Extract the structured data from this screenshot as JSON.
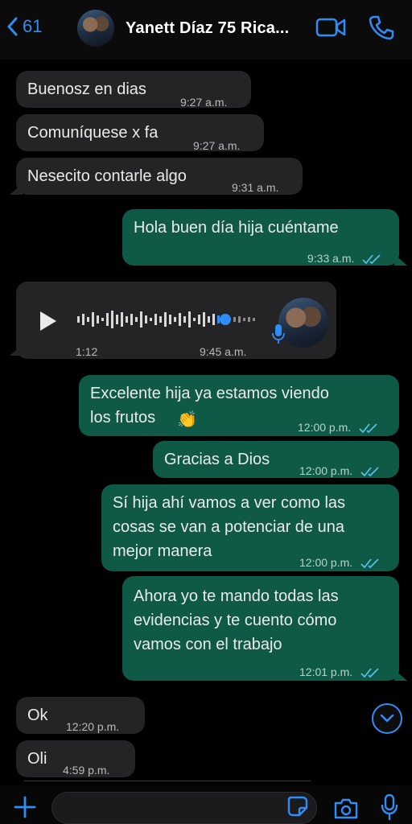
{
  "header": {
    "back_count": "61",
    "contact_name": "Yanett Díaz 75 Rica..."
  },
  "messages": [
    {
      "text": "Buenosz en dias",
      "time": "9:27 a.m."
    },
    {
      "text": "Comuníquese x fa",
      "time": "9:27 a.m."
    },
    {
      "text": "Nesecito contarle algo",
      "time": "9:31 a.m."
    },
    {
      "text": "Hola buen día hija cuéntame",
      "time": "9:33 a.m."
    },
    {
      "duration": "1:12",
      "time": "9:45 a.m."
    },
    {
      "text_line1": "Excelente hija ya estamos viendo",
      "text_line2": "los frutos",
      "emoji": "👏",
      "time": "12:00 p.m."
    },
    {
      "text": "Gracias a Dios",
      "time": "12:00 p.m."
    },
    {
      "text_line1": "Sí hija ahí vamos a ver como las",
      "text_line2": "cosas se van a potenciar de una",
      "text_line3": "mejor manera",
      "time": "12:00 p.m."
    },
    {
      "text_line1": "Ahora yo te mando todas las",
      "text_line2": "evidencias y te cuento cómo",
      "text_line3": "vamos con el trabajo",
      "time": "12:01 p.m."
    },
    {
      "text": "Ok",
      "time": "12:20 p.m."
    },
    {
      "text": "Oli",
      "time": "4:59 p.m."
    }
  ],
  "colors": {
    "accent": "#2f8df5",
    "incoming_bubble": "#242426",
    "outgoing_bubble": "#0f5a47",
    "read_ticks": "#53bdeb"
  },
  "icons": [
    "chevron-left-icon",
    "video-call-icon",
    "phone-icon",
    "play-icon",
    "microphone-icon",
    "chevron-down-icon",
    "plus-icon",
    "sticker-icon",
    "camera-icon",
    "read-ticks-icon"
  ]
}
